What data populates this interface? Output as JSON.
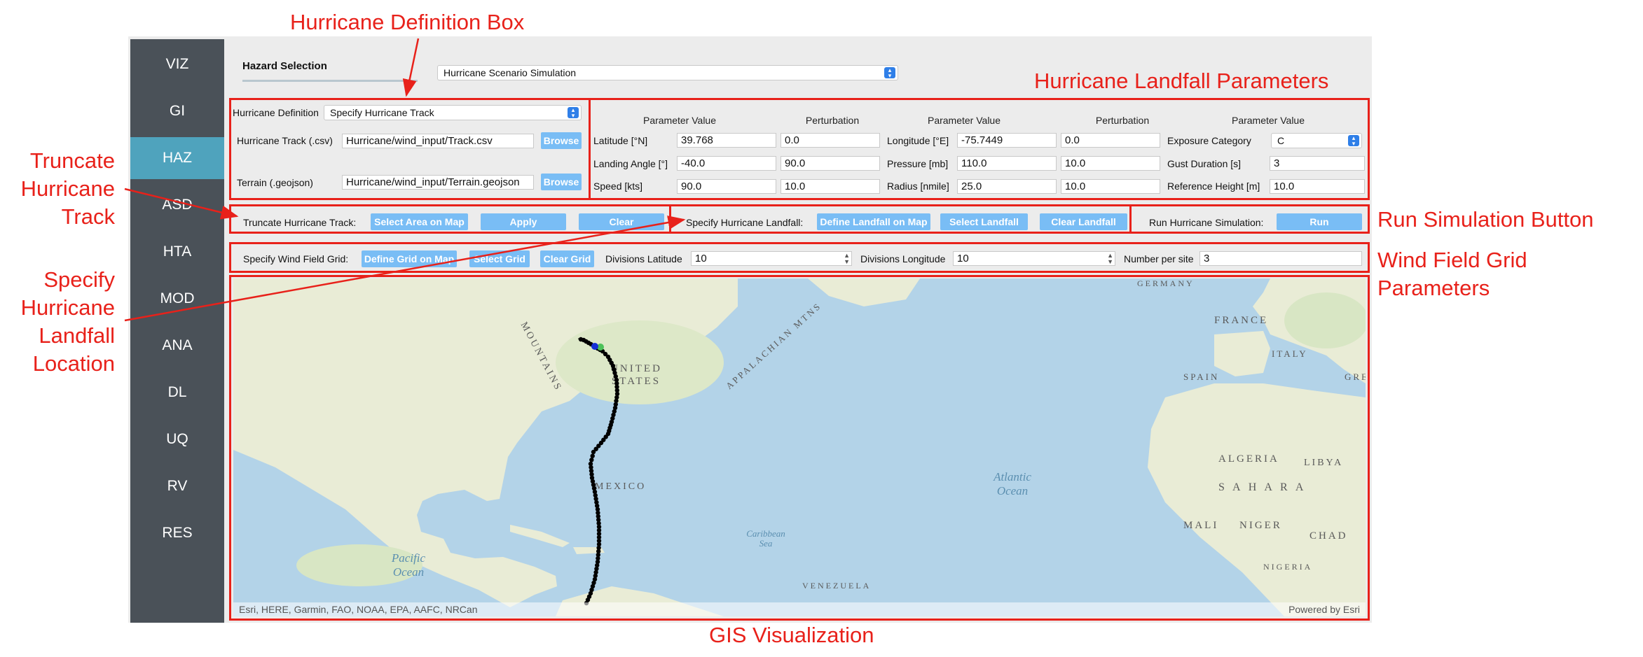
{
  "annotations": {
    "hurricane_definition_box": "Hurricane Definition Box",
    "landfall_parameters": "Hurricane Landfall Parameters",
    "truncate_track": [
      "Truncate",
      "Hurricane",
      "Track"
    ],
    "specify_landfall": [
      "Specify",
      "Hurricane",
      "Landfall",
      "Location"
    ],
    "run_simulation_button": "Run Simulation Button",
    "wind_field_grid": [
      "Wind Field Grid",
      "Parameters"
    ],
    "gis_visualization": "GIS Visualization"
  },
  "sidebar": {
    "items": [
      {
        "label": "VIZ"
      },
      {
        "label": "GI"
      },
      {
        "label": "HAZ",
        "active": true
      },
      {
        "label": "ASD"
      },
      {
        "label": "HTA"
      },
      {
        "label": "MOD"
      },
      {
        "label": "ANA"
      },
      {
        "label": "DL"
      },
      {
        "label": "UQ"
      },
      {
        "label": "RV"
      },
      {
        "label": "RES"
      }
    ]
  },
  "hazard": {
    "title": "Hazard Selection",
    "selection_value": "Hurricane Scenario Simulation"
  },
  "definition": {
    "label": "Hurricane Definition",
    "value": "Specify Hurricane Track",
    "track_label": "Hurricane Track (.csv)",
    "track_value": "Hurricane/wind_input/Track.csv",
    "terrain_label": "Terrain (.geojson)",
    "terrain_value": "Hurricane/wind_input/Terrain.geojson",
    "browse_label": "Browse"
  },
  "landfall_params": {
    "headers": [
      "Parameter Value",
      "Perturbation",
      "Parameter Value",
      "Perturbation",
      "Parameter Value"
    ],
    "latitude": {
      "label": "Latitude [°N]",
      "value": "39.768",
      "perturbation": "0.0"
    },
    "landing_angle": {
      "label": "Landing Angle [°]",
      "value": "-40.0",
      "perturbation": "90.0"
    },
    "speed": {
      "label": "Speed [kts]",
      "value": "90.0",
      "perturbation": "10.0"
    },
    "longitude": {
      "label": "Longitude [°E]",
      "value": "-75.7449",
      "perturbation": "0.0"
    },
    "pressure": {
      "label": "Pressure [mb]",
      "value": "110.0",
      "perturbation": "10.0"
    },
    "radius": {
      "label": "Radius [nmile]",
      "value": "25.0",
      "perturbation": "10.0"
    },
    "exposure": {
      "label": "Exposure Category",
      "value": "C"
    },
    "gust": {
      "label": "Gust Duration [s]",
      "value": "3"
    },
    "ref_height": {
      "label": "Reference Height [m]",
      "value": "10.0"
    }
  },
  "truncate": {
    "label": "Truncate Hurricane Track:",
    "select_button": "Select Area on Map",
    "apply_button": "Apply",
    "clear_button": "Clear"
  },
  "landfall": {
    "label": "Specify Hurricane Landfall:",
    "define_button": "Define Landfall on Map",
    "select_button": "Select Landfall",
    "clear_button": "Clear Landfall"
  },
  "run": {
    "label": "Run Hurricane Simulation:",
    "button": "Run"
  },
  "grid": {
    "label": "Specify Wind Field Grid:",
    "define_button": "Define Grid on Map",
    "select_button": "Select Grid",
    "clear_button": "Clear Grid",
    "div_lat_label": "Divisions Latitude",
    "div_lat_value": "10",
    "div_lon_label": "Divisions Longitude",
    "div_lon_value": "10",
    "per_site_label": "Number per site",
    "per_site_value": "3"
  },
  "map": {
    "labels": {
      "germany": "GERMANY",
      "france": "FRANCE",
      "spain": "SPAIN",
      "italy": "ITALY",
      "greece": "GREE",
      "united_states": "UNITED STATES",
      "mountains": "MOUNTAINS",
      "appalachian": "APPALACHIAN MTNS",
      "mexico": "MEXICO",
      "algeria": "ALGERIA",
      "libya": "LIBYA",
      "sahara": "S A H A R A",
      "mali": "MALI",
      "niger": "NIGER",
      "chad": "CHAD",
      "nigeria": "NIGERIA",
      "venezuela": "VENEZUELA",
      "caribbean": "Caribbean Sea",
      "atlantic": "Atlantic Ocean",
      "pacific": "Pacific Ocean"
    },
    "attribution": "Esri, HERE, Garmin, FAO, NOAA, EPA, AAFC, NRCan",
    "powered_by": "Powered by Esri",
    "colors": {
      "water": "#b3d3e8",
      "land": "#e9ecd6",
      "track": "#000000",
      "landfall_marker": "#1530d6"
    }
  }
}
